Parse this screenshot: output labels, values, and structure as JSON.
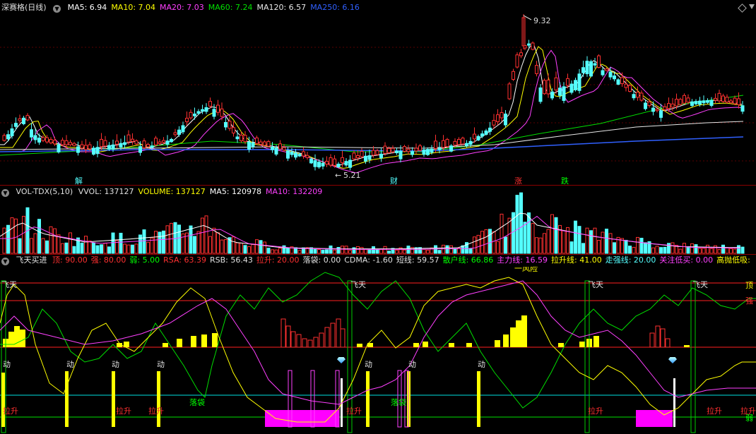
{
  "colors": {
    "up": "#ff3030",
    "down": "#54ffff",
    "ma5": "#ffffff",
    "ma10": "#ffff00",
    "ma20": "#ff40ff",
    "ma60": "#00e000",
    "ma120": "#e8e8e8",
    "ma250": "#3060ff",
    "volma": "#ffffff"
  },
  "main": {
    "title": "深赛格(日线)",
    "legend": [
      {
        "label": "MA5: 6.94",
        "color": "#ffffff"
      },
      {
        "label": "MA10: 7.04",
        "color": "#ffff00"
      },
      {
        "label": "MA20: 7.03",
        "color": "#ff40ff"
      },
      {
        "label": "MA60: 7.24",
        "color": "#00e000"
      },
      {
        "label": "MA120: 6.57",
        "color": "#e8e8e8"
      },
      {
        "label": "MA250: 6.16",
        "color": "#3060ff"
      }
    ],
    "high_label": "9.32",
    "low_label": "5.21",
    "event_labels": [
      {
        "text": "解",
        "color": "#54ffff"
      },
      {
        "text": "财",
        "color": "#54ffff"
      },
      {
        "text": "涨",
        "color": "#ff3030"
      },
      {
        "text": "跌",
        "color": "#00ff00"
      }
    ]
  },
  "volume": {
    "title": "VOL-TDX(5,10)",
    "legend": [
      {
        "label": "VVOL: 137127",
        "color": "#e0e0e0"
      },
      {
        "label": "VOLUME: 137127",
        "color": "#ffff00"
      },
      {
        "label": "MA5: 120978",
        "color": "#ffffff"
      },
      {
        "label": "MA10: 132209",
        "color": "#ff40ff"
      }
    ]
  },
  "indicator": {
    "title": "飞天买进",
    "legend": [
      {
        "label": "顶: 90.00",
        "color": "#ff3030"
      },
      {
        "label": "强: 80.00",
        "color": "#ff3030"
      },
      {
        "label": "弱: 5.00",
        "color": "#00ff00"
      },
      {
        "label": "RSA: 63.39",
        "color": "#ff3030"
      },
      {
        "label": "RSB: 56.43",
        "color": "#e0e0e0"
      },
      {
        "label": "拉升: 20.00",
        "color": "#ff3030"
      },
      {
        "label": "落袋: 0.00",
        "color": "#e0e0e0"
      },
      {
        "label": "CDMA: -1.60",
        "color": "#e0e0e0"
      },
      {
        "label": "短线: 59.57",
        "color": "#e0e0e0"
      },
      {
        "label": "散户线: 66.86",
        "color": "#00ff00"
      },
      {
        "label": "主力线: 16.59",
        "color": "#ff40ff"
      },
      {
        "label": "拉升线: 41.00",
        "color": "#ffff00"
      },
      {
        "label": "走强线: 20.00",
        "color": "#54ffff"
      },
      {
        "label": "关注低买: 0.00",
        "color": "#ff40ff"
      },
      {
        "label": "高抛低吸:",
        "color": "#ffff00"
      }
    ],
    "top_label": "一风险",
    "right_top": "顶",
    "right_strong": "强",
    "right_weak": "弱",
    "feitian": [
      "飞天",
      "飞天",
      "飞天",
      "飞天"
    ],
    "dong": [
      "动",
      "动",
      "动",
      "动",
      "动",
      "动",
      "动",
      "动"
    ],
    "lasheng": [
      "拉升",
      "拉升",
      "拉升",
      "拉升",
      "拉升",
      "拉升",
      "拉升"
    ],
    "luodai": [
      "落袋",
      "落袋"
    ]
  }
}
